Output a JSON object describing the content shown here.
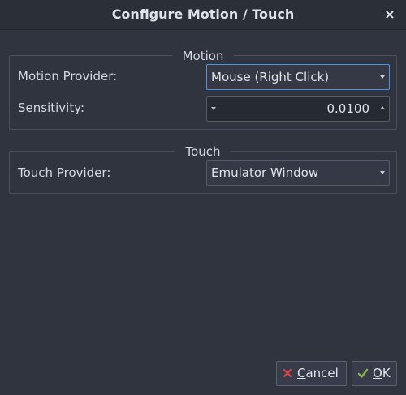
{
  "window": {
    "title": "Configure Motion / Touch",
    "close_glyph": "×"
  },
  "motion": {
    "group_title": "Motion",
    "provider_label": "Motion Provider:",
    "provider_value": "Mouse (Right Click)",
    "sensitivity_label": "Sensitivity:",
    "sensitivity_value": "0.0100"
  },
  "touch": {
    "group_title": "Touch",
    "provider_label": "Touch Provider:",
    "provider_value": "Emulator Window"
  },
  "buttons": {
    "cancel_mnemonic": "C",
    "cancel_rest": "ancel",
    "ok_mnemonic": "O",
    "ok_rest": "K"
  },
  "icons": {
    "cancel": "x-mark-icon",
    "ok": "checkmark-icon",
    "close": "close-icon",
    "dropdown": "chevron-down-icon"
  },
  "colors": {
    "background": "#2f343f",
    "accent": "#5294e2",
    "text": "#d3dae3",
    "cancel_icon": "#e0404a",
    "ok_icon": "#8ab34a"
  }
}
